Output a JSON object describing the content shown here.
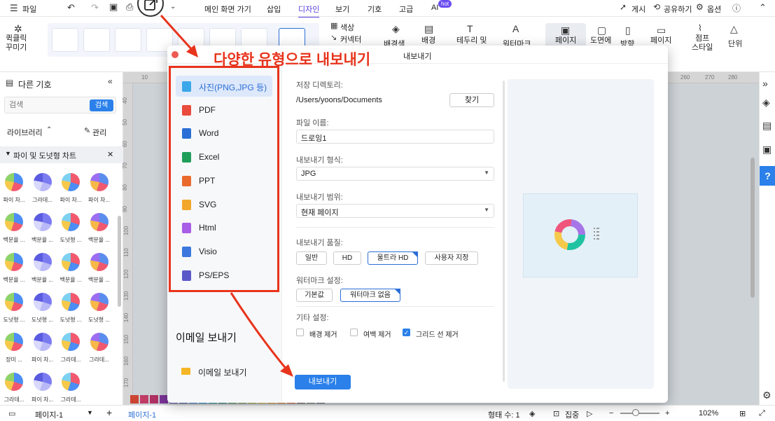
{
  "menubar": {
    "file": "파일",
    "tabs": [
      "메인 화면 가기",
      "삽입",
      "디자인",
      "보기",
      "기호",
      "고급",
      "AI"
    ],
    "active_tab": "디자인",
    "hot_badge": "hot",
    "publish": "게시",
    "share": "공유하기",
    "options": "옵션"
  },
  "toolbar": {
    "quick_style": "퀵클릭\n꾸미기",
    "color": "색상",
    "connector": "커넥터",
    "background_color": "배경색",
    "background": "배경",
    "border_title": "테두리 및",
    "watermark": "워터마크",
    "page": "페이지",
    "drawing": "도면에",
    "direction": "방향",
    "page_size": "페이지",
    "jump_style": "점프\n스타일",
    "unit": "단위"
  },
  "left_panel": {
    "title": "다른 기호",
    "search_placeholder": "검색",
    "search_button": "검색",
    "library": "라이브러리",
    "manage": "관리",
    "category": "파이 및 도넛형 차트",
    "shapes": [
      "파이 차...",
      "그라데...",
      "파이 차...",
      "파이 차...",
      "백분율 ...",
      "백분율 ...",
      "도넛형 ...",
      "백분율 ...",
      "백분율 ...",
      "백분율 ...",
      "백분율 ...",
      "백분율 ...",
      "도넛형 ...",
      "도넛형 ...",
      "도넛형 ...",
      "도넛형 ...",
      "장미 ...",
      "파이 차...",
      "그라데...",
      "그라데...",
      "그라데...",
      "파이 차...",
      "그라데..."
    ]
  },
  "rulers": {
    "top": [
      "10",
      "260",
      "270",
      "280"
    ],
    "left": [
      "40",
      "50",
      "60",
      "70",
      "80",
      "90",
      "100",
      "110",
      "120",
      "130",
      "140",
      "150",
      "160",
      "170"
    ]
  },
  "statusbar": {
    "page_selector": "페이지-1",
    "add_page": "+",
    "current_page": "페이지-1",
    "shape_count": "형태 수: 1",
    "focus": "집중",
    "zoom": "102%"
  },
  "annotation": {
    "title": "다양한 유형으로 내보내기"
  },
  "dialog": {
    "title": "내보내기",
    "formats": [
      {
        "label": "사진(PNG,JPG 등)",
        "icon": "image-icon",
        "color": "#3aa7e8"
      },
      {
        "label": "PDF",
        "icon": "pdf-icon",
        "color": "#e94b3c"
      },
      {
        "label": "Word",
        "icon": "word-icon",
        "color": "#2b6fd6"
      },
      {
        "label": "Excel",
        "icon": "excel-icon",
        "color": "#1f9e5a"
      },
      {
        "label": "PPT",
        "icon": "ppt-icon",
        "color": "#ea6a2e"
      },
      {
        "label": "SVG",
        "icon": "svg-icon",
        "color": "#f2a62a"
      },
      {
        "label": "Html",
        "icon": "html-icon",
        "color": "#a85ee6"
      },
      {
        "label": "Visio",
        "icon": "visio-icon",
        "color": "#3c78dd"
      },
      {
        "label": "PS/EPS",
        "icon": "ps-eps-icon",
        "color": "#5a58c8"
      }
    ],
    "email_section": "이메일 보내기",
    "email_item": "이메일 보내기",
    "save_dir_label": "저장 디렉토리:",
    "save_dir_value": "/Users/yoons/Documents",
    "find_button": "찾기",
    "filename_label": "파일 이름:",
    "filename_value": "드로잉1",
    "format_label": "내보내기 형식:",
    "format_value": "JPG",
    "range_label": "내보내기 범위:",
    "range_value": "현재 페이지",
    "quality_label": "내보내기 품질:",
    "quality_options": [
      "일반",
      "HD",
      "울트라 HD",
      "사용자 지정"
    ],
    "quality_selected": "울트라 HD",
    "watermark_label": "워터마크 설정:",
    "watermark_options": [
      "기본값",
      "워터마크 없음"
    ],
    "watermark_selected": "워터마크 없음",
    "other_label": "기타 설정:",
    "other_options": [
      {
        "label": "배경 제거",
        "checked": false
      },
      {
        "label": "여백 제거",
        "checked": false
      },
      {
        "label": "그리드 선 제거",
        "checked": true
      }
    ],
    "export_button": "내보내기"
  },
  "colors": {
    "accent": "#2b80ea",
    "annotation": "#e8341c",
    "active_tab": "#5a3de0"
  }
}
